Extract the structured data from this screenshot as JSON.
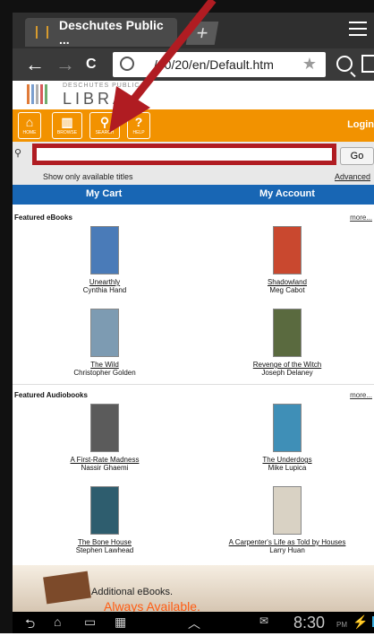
{
  "browser": {
    "tab_title": "Deschutes Public ...",
    "new_tab_symbol": "+",
    "url": "/40/20/en/Default.htm",
    "back": "←",
    "forward": "→",
    "reload": "C",
    "star": "★"
  },
  "site": {
    "logo_small": "DESCHUTES PUBLIC",
    "logo_big": "LIBRA",
    "nav": [
      {
        "label": "HOME",
        "icon": "home-icon"
      },
      {
        "label": "BROWSE",
        "icon": "book-icon"
      },
      {
        "label": "SEARCH",
        "icon": "search-icon"
      },
      {
        "label": "HELP",
        "icon": "help-icon"
      }
    ],
    "login": "Login",
    "go": "Go",
    "advanced": "Advanced",
    "available_label": "Show only available titles",
    "my_cart": "My Cart",
    "my_account": "My Account"
  },
  "featured_ebooks": {
    "title": "Featured eBooks",
    "more": "more...",
    "items": [
      {
        "title": "Unearthly",
        "author": "Cynthia Hand",
        "cover_color": "#4a7bb8"
      },
      {
        "title": "Shadowland",
        "author": "Meg Cabot",
        "cover_color": "#c9482f"
      },
      {
        "title": "The Wild",
        "author": "Christopher Golden",
        "cover_color": "#7d9bb2"
      },
      {
        "title": "Revenge of the Witch",
        "author": "Joseph Delaney",
        "cover_color": "#5a6a3f"
      }
    ]
  },
  "featured_audiobooks": {
    "title": "Featured Audiobooks",
    "more": "more...",
    "items": [
      {
        "title": "A First-Rate Madness",
        "author": "Nassir Ghaemi",
        "cover_color": "#5b5b5b"
      },
      {
        "title": "The Underdogs",
        "author": "Mike Lupica",
        "cover_color": "#3f8fb7"
      },
      {
        "title": "The Bone House",
        "author": "Stephen Lawhead",
        "cover_color": "#2e5d6e"
      },
      {
        "title": "A Carpenter's Life as Told by Houses",
        "author": "Larry Huan",
        "cover_color": "#d9d2c4"
      }
    ]
  },
  "promo": {
    "line1": "Additional eBooks.",
    "line2": "Always Available."
  },
  "status": {
    "time": "8:30",
    "ampm": "PM"
  }
}
